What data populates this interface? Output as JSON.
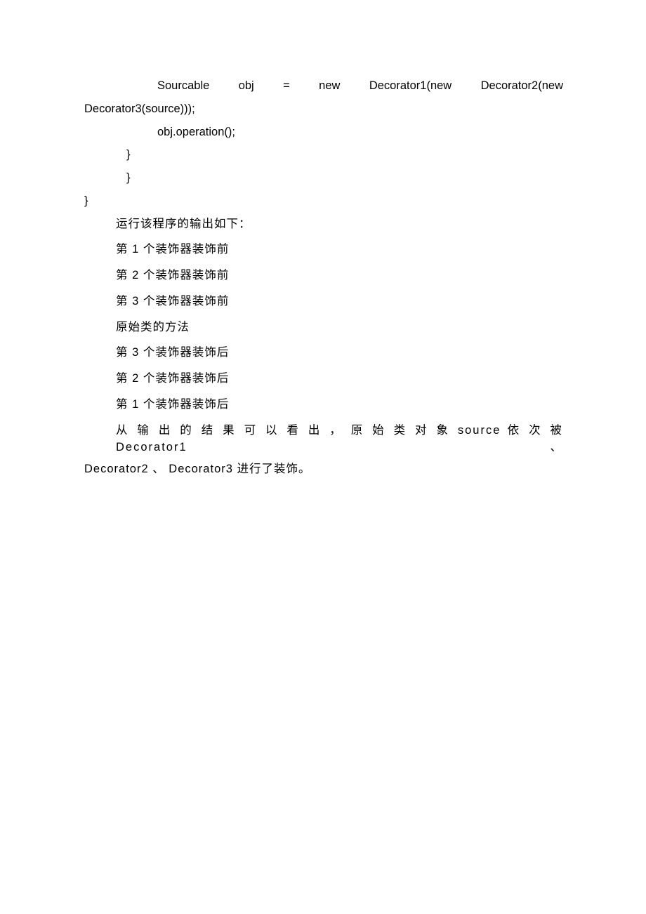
{
  "code": {
    "line1a": "Sourcable    obj    =    new    Decorator1(new    Decorator2(new",
    "line1b": "Decorator3(source)));",
    "line2": "obj.operation();",
    "brace1": "}",
    "brace2": "}",
    "brace3": "}"
  },
  "intro": "运行该程序的输出如下：",
  "outputs": [
    "第 1 个装饰器装饰前",
    "第 2 个装饰器装饰前",
    "第 3 个装饰器装饰前",
    "原始类的方法",
    "第 3 个装饰器装饰后",
    "第 2 个装饰器装饰后",
    "第 1 个装饰器装饰后"
  ],
  "summary_line1": "从 输 出 的 结 果 可 以 看 出 ， 原 始 类 对 象 source  依 次 被  Decorator1 、",
  "summary_line2": "Decorator2 、 Decorator3 进行了装饰。"
}
